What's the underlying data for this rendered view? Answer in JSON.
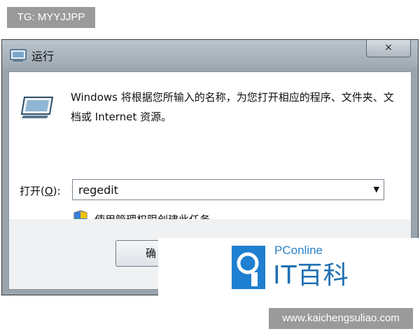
{
  "watermark_top": {
    "text": "TG: MYYJJPP"
  },
  "dialog": {
    "title": "运行",
    "close_glyph": "×",
    "icon": "run-window-icon",
    "description": "Windows 将根据您所输入的名称，为您打开相应的程序、文件夹、文档或 Internet 资源。",
    "open_label_prefix": "打开(",
    "open_label_accel": "O",
    "open_label_suffix": "):",
    "command_value": "regedit",
    "dropdown_glyph": "▼",
    "admin_icon": "uac-shield-icon",
    "admin_text": "使用管理权限创建此任务。",
    "ok_button_visible": "确"
  },
  "brand_overlay": {
    "logo": "pconline-logo-icon",
    "top_text": "PConline",
    "main_text": "IT百科"
  },
  "watermark_bottom": {
    "text": "www.kaichengsuliao.com"
  }
}
